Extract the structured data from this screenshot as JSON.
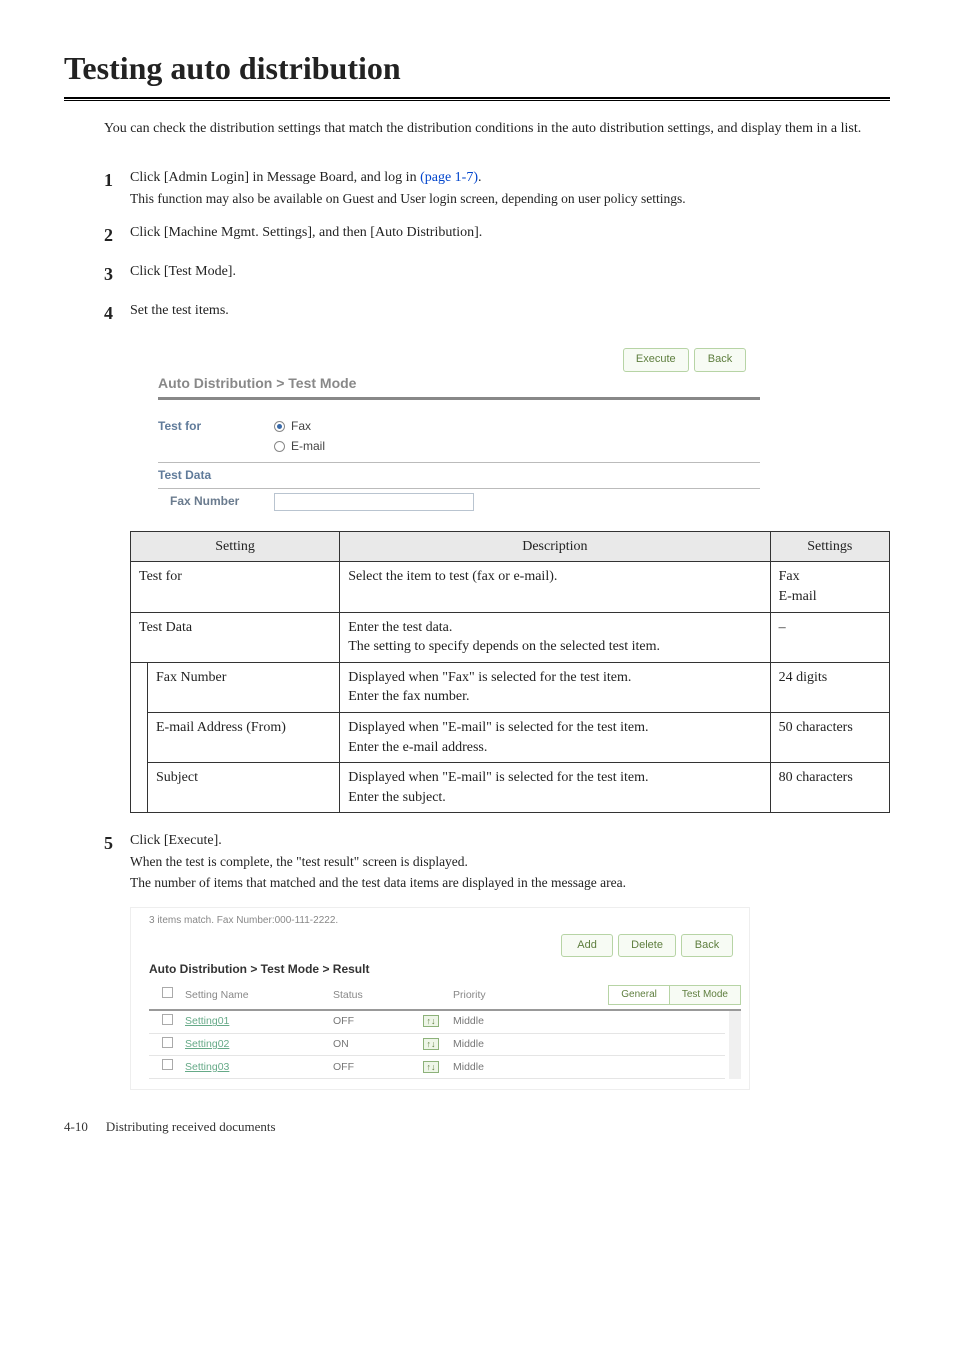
{
  "title": "Testing auto distribution",
  "intro": "You can check the distribution settings that match the distribution conditions in the auto distribution settings, and display them in a list.",
  "steps": {
    "s1": {
      "num": "1",
      "text_a": "Click [Admin Login] in Message Board, and log in ",
      "link": "(page 1-7)",
      "text_b": ".",
      "note": "This function may also be available on Guest and User login screen, depending on user policy settings."
    },
    "s2": {
      "num": "2",
      "text": "Click [Machine Mgmt. Settings], and then [Auto Distribution]."
    },
    "s3": {
      "num": "3",
      "text": "Click [Test Mode]."
    },
    "s4": {
      "num": "4",
      "text": "Set the test items."
    },
    "s5": {
      "num": "5",
      "text": "Click [Execute].",
      "note1": "When the test is complete, the \"test result\" screen is displayed.",
      "note2": "The number of items that matched and the test data items are displayed in the message area."
    }
  },
  "panel1": {
    "btn_execute": "Execute",
    "btn_back": "Back",
    "title": "Auto Distribution > Test Mode",
    "test_for_label": "Test for",
    "opt_fax": "Fax",
    "opt_email": "E-mail",
    "test_data_label": "Test Data",
    "fax_number_label": "Fax Number"
  },
  "table": {
    "h1": "Setting",
    "h2": "Description",
    "h3": "Settings",
    "r1c1": "Test for",
    "r1c2": "Select the item to test (fax or e-mail).",
    "r1c3": "Fax\nE-mail",
    "r2c1": "Test Data",
    "r2c2": "Enter the test data.\nThe setting to specify depends on the selected test item.",
    "r2c3": "–",
    "r3c1": "Fax Number",
    "r3c2": "Displayed when \"Fax\" is selected for the test item.\nEnter the fax number.",
    "r3c3": "24 digits",
    "r4c1": "E-mail Address (From)",
    "r4c2": "Displayed when \"E-mail\" is selected for the test item.\nEnter the e-mail address.",
    "r4c3": "50 characters",
    "r5c1": "Subject",
    "r5c2": "Displayed when \"E-mail\" is selected for the test item.\nEnter the subject.",
    "r5c3": "80 characters"
  },
  "panel2": {
    "msg": "3 items match. Fax Number:000-111-2222.",
    "btn_add": "Add",
    "btn_delete": "Delete",
    "btn_back": "Back",
    "title": "Auto Distribution > Test Mode > Result",
    "h_name": "Setting Name",
    "h_status": "Status",
    "h_priority": "Priority",
    "tab_general": "General",
    "tab_test": "Test Mode",
    "rows": [
      {
        "name": "Setting01",
        "status": "OFF",
        "priority": "Middle"
      },
      {
        "name": "Setting02",
        "status": "ON",
        "priority": "Middle"
      },
      {
        "name": "Setting03",
        "status": "OFF",
        "priority": "Middle"
      }
    ]
  },
  "footer": {
    "page": "4-10",
    "chapter": "Distributing received documents"
  }
}
